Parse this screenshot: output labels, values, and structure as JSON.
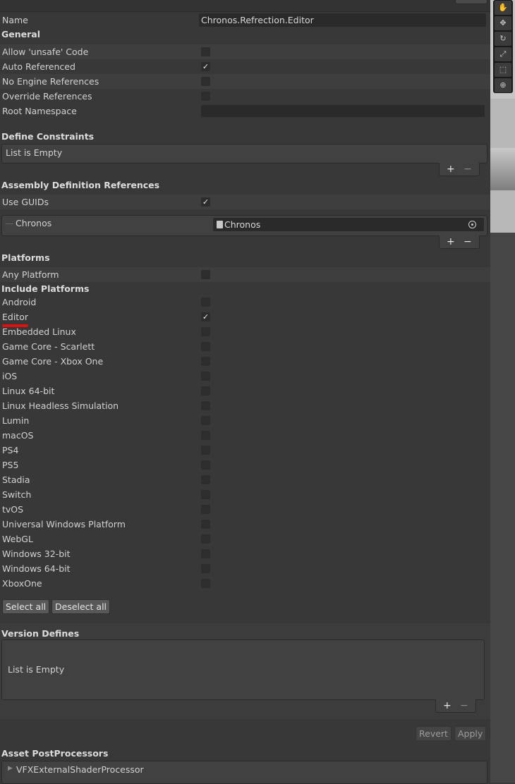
{
  "name": {
    "label": "Name",
    "value": "Chronos.Refrection.Editor"
  },
  "general": {
    "header": "General",
    "rows": [
      {
        "label": "Allow 'unsafe' Code",
        "check": ""
      },
      {
        "label": "Auto Referenced",
        "check": "✓"
      },
      {
        "label": "No Engine References",
        "check": ""
      },
      {
        "label": "Override References",
        "check": ""
      }
    ],
    "root_namespace_label": "Root Namespace"
  },
  "define_constraints": {
    "header": "Define Constraints",
    "empty_text": "List is Empty",
    "plus": "+",
    "minus": "−"
  },
  "assembly_refs": {
    "header": "Assembly Definition References",
    "use_guids_label": "Use GUIDs",
    "use_guids_check": "✓",
    "item_label": "Chronos",
    "item_value": "Chronos",
    "plus": "+",
    "minus": "−"
  },
  "platforms": {
    "header": "Platforms",
    "any_platform_label": "Any Platform",
    "include_header": "Include Platforms",
    "items": [
      {
        "label": "Android",
        "check": ""
      },
      {
        "label": "Editor",
        "check": "✓"
      },
      {
        "label": "Embedded Linux",
        "check": ""
      },
      {
        "label": "Game Core - Scarlett",
        "check": ""
      },
      {
        "label": "Game Core - Xbox One",
        "check": ""
      },
      {
        "label": "iOS",
        "check": ""
      },
      {
        "label": "Linux 64-bit",
        "check": ""
      },
      {
        "label": "Linux Headless Simulation",
        "check": ""
      },
      {
        "label": "Lumin",
        "check": ""
      },
      {
        "label": "macOS",
        "check": ""
      },
      {
        "label": "PS4",
        "check": ""
      },
      {
        "label": "PS5",
        "check": ""
      },
      {
        "label": "Stadia",
        "check": ""
      },
      {
        "label": "Switch",
        "check": ""
      },
      {
        "label": "tvOS",
        "check": ""
      },
      {
        "label": "Universal Windows Platform",
        "check": ""
      },
      {
        "label": "WebGL",
        "check": ""
      },
      {
        "label": "Windows 32-bit",
        "check": ""
      },
      {
        "label": "Windows 64-bit",
        "check": ""
      },
      {
        "label": "XboxOne",
        "check": ""
      }
    ],
    "select_all": "Select all",
    "deselect_all": "Deselect all"
  },
  "version_defines": {
    "header": "Version Defines",
    "empty_text": "List is Empty",
    "plus": "+",
    "minus": "−"
  },
  "actions": {
    "revert": "Revert",
    "apply": "Apply"
  },
  "postprocessors": {
    "header": "Asset PostProcessors",
    "item": "VFXExternalShaderProcessor"
  },
  "scene_tools": [
    "hand-tool",
    "move-tool",
    "rotate-tool",
    "scale-tool",
    "rect-tool",
    "transform-tool"
  ],
  "colors": {
    "annotation": "#e01010",
    "panel": "#383838"
  }
}
